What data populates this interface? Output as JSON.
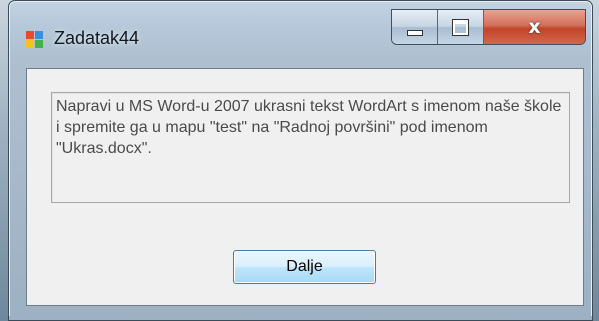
{
  "window": {
    "title": "Zadatak44",
    "controls": {
      "minimize_icon": "minimize-icon",
      "maximize_icon": "maximize-icon",
      "close_label": "x"
    }
  },
  "message": {
    "text": "Napravi u MS Word-u 2007 ukrasni tekst WordArt s imenom naše škole i spremite ga u mapu \"test\" na \"Radnoj površini\" pod imenom \"Ukras.docx\"."
  },
  "actions": {
    "next_label": "Dalje"
  },
  "colors": {
    "accent": "#3c7fb1",
    "close": "#c1442a"
  }
}
